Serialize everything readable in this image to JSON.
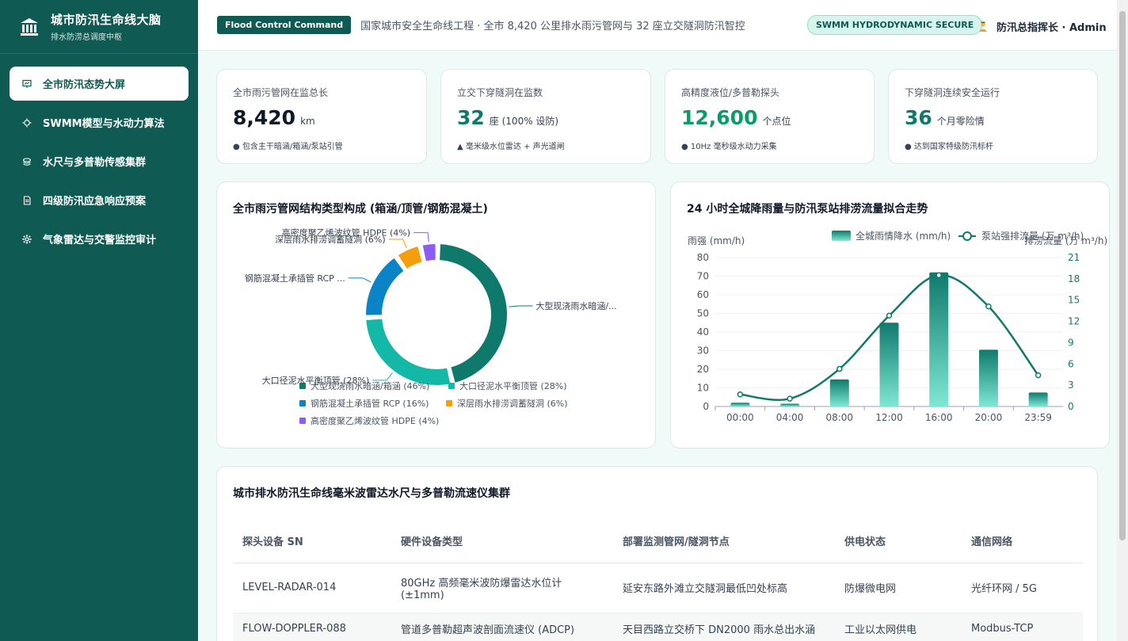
{
  "sidebar": {
    "title": "城市防汛生命线大脑",
    "subtitle": "排水防涝总调度中枢",
    "items": [
      {
        "label": "全市防汛态势大屏",
        "icon": "presentation-icon",
        "active": true
      },
      {
        "label": "SWMM模型与水动力算法",
        "icon": "sun-gear-icon",
        "active": false
      },
      {
        "label": "水尺与多普勒传感集群",
        "icon": "stack-icon",
        "active": false
      },
      {
        "label": "四级防汛应急响应预案",
        "icon": "document-icon",
        "active": false
      },
      {
        "label": "气象雷达与交警监控审计",
        "icon": "gear-icon",
        "active": false
      }
    ]
  },
  "header": {
    "tag": "Flood Control Command",
    "description": "国家城市安全生命线工程 · 全市 8,420 公里排水雨污管网与 32 座立交隧洞防汛智控",
    "badge": "SWMM HYDRODYNAMIC SECURE",
    "user": "防汛总指挥长 · Admin"
  },
  "stats": [
    {
      "label": "全市雨污管网在监总长",
      "value": "8,420",
      "unit": "km",
      "note": "● 包含主干暗涵/箱涵/泵站引管",
      "color": "#111827"
    },
    {
      "label": "立交下穿隧洞在监数",
      "value": "32",
      "unit": "座 (100% 设防)",
      "note": "▲ 毫米级水位雷达 + 声光道闸",
      "color": "#0f7a6c"
    },
    {
      "label": "高精度液位/多普勒探头",
      "value": "12,600",
      "unit": "个点位",
      "note": "● 10Hz 毫秒级水动力采集",
      "color": "#0c9a6a"
    },
    {
      "label": "下穿隧洞连续安全运行",
      "value": "36",
      "unit": "个月零险情",
      "note": "● 达到国家特级防汛标杆",
      "color": "#0f7a6c"
    }
  ],
  "donut_panel": {
    "title": "全市雨污管网结构类型构成 (箱涵/顶管/钢筋混凝土)"
  },
  "combo_panel": {
    "title": "24 小时全城降雨量与防汛泵站排涝流量拟合走势"
  },
  "chart_data": [
    {
      "type": "pie",
      "title": "全市雨污管网结构类型构成 (箱涵/顶管/钢筋混凝土)",
      "legend_position": "bottom",
      "slices": [
        {
          "name": "大型现浇雨水暗涵/箱涵",
          "value": 46,
          "label": "大型现浇雨水暗涵/...",
          "legend": "大型现浇雨水暗涵/箱涵 (46%)",
          "color": "#0f7a6c"
        },
        {
          "name": "大口径泥水平衡顶管",
          "value": 28,
          "label": "大口径泥水平衡顶管 (28%)",
          "legend": "大口径泥水平衡顶管 (28%)",
          "color": "#14b8a6"
        },
        {
          "name": "钢筋混凝土承插管 RCP",
          "value": 16,
          "label": "钢筋混凝土承插管 RCP ...",
          "legend": "钢筋混凝土承插管 RCP (16%)",
          "color": "#0a84c6"
        },
        {
          "name": "深层雨水排涝调蓄隧洞",
          "value": 6,
          "label": "深层雨水排涝调蓄隧洞 (6%)",
          "legend": "深层雨水排涝调蓄隧洞 (6%)",
          "color": "#f59e0b"
        },
        {
          "name": "高密度聚乙烯波纹管 HDPE",
          "value": 4,
          "label": "高密度聚乙烯波纹管 HDPE (4%)",
          "legend": "高密度聚乙烯波纹管 HDPE (4%)",
          "color": "#8b5cf6"
        }
      ]
    },
    {
      "type": "bar",
      "title": "24 小时全城降雨量与防汛泵站排涝流量拟合走势",
      "categories": [
        "00:00",
        "04:00",
        "08:00",
        "12:00",
        "16:00",
        "20:00",
        "23:59"
      ],
      "ylabel": "雨强 (mm/h)",
      "y2label": "排涝流量 (万 m³/h)",
      "ylim": [
        0,
        80
      ],
      "y2lim": [
        0,
        21
      ],
      "yticks": [
        0,
        10,
        20,
        30,
        40,
        50,
        60,
        70,
        80
      ],
      "y2ticks": [
        0,
        3,
        6,
        9,
        12,
        15,
        18,
        21
      ],
      "legend_position": "top-right",
      "series": [
        {
          "name": "全城雨情降水 (mm/h)",
          "type": "bar",
          "axis": "left",
          "values": [
            2,
            1.5,
            14.5,
            45,
            72,
            30.5,
            7.5
          ],
          "color": "#14b8a6"
        },
        {
          "name": "泵站强排流量 (万 m³/h)",
          "type": "line",
          "axis": "right",
          "values": [
            1.7,
            1.1,
            5.3,
            12.8,
            18.5,
            14.1,
            4.4
          ],
          "color": "#0f7a6c"
        }
      ]
    }
  ],
  "table": {
    "title": "城市排水防汛生命线毫米波雷达水尺与多普勒流速仪集群",
    "headers": [
      "探头设备 SN",
      "硬件设备类型",
      "部署监测管网/隧洞节点",
      "供电状态",
      "通信网络"
    ],
    "rows": [
      [
        "LEVEL-RADAR-014",
        "80GHz 高频毫米波防爆雷达水位计 (±1mm)",
        "延安东路外滩立交隧洞最低凹处标高",
        "防爆微电网",
        "光纤环网 / 5G"
      ],
      [
        "FLOW-DOPPLER-088",
        "管道多普勒超声波剖面流速仪 (ADCP)",
        "天目西路立交桥下 DN2000 雨水总出水涵",
        "工业以太网供电",
        "Modbus-TCP"
      ]
    ]
  }
}
